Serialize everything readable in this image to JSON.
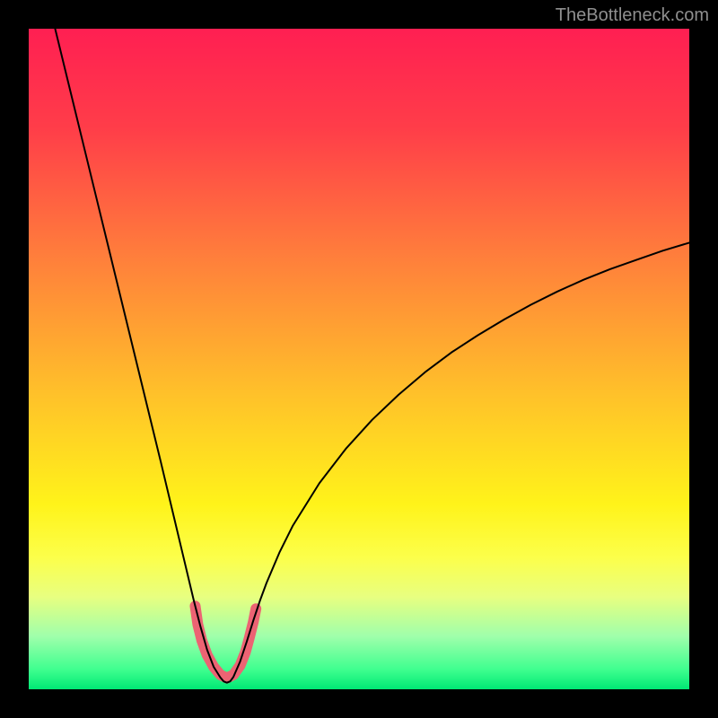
{
  "watermark": "TheBottleneck.com",
  "chart_data": {
    "type": "line",
    "title": "",
    "xlabel": "",
    "ylabel": "",
    "xlim": [
      0,
      100
    ],
    "ylim": [
      0,
      100
    ],
    "gradient_stops": [
      {
        "offset": 0.0,
        "color": "#ff1f52"
      },
      {
        "offset": 0.15,
        "color": "#ff3d49"
      },
      {
        "offset": 0.35,
        "color": "#ff803b"
      },
      {
        "offset": 0.55,
        "color": "#ffc02a"
      },
      {
        "offset": 0.72,
        "color": "#fff31a"
      },
      {
        "offset": 0.8,
        "color": "#fcff4a"
      },
      {
        "offset": 0.86,
        "color": "#e8ff80"
      },
      {
        "offset": 0.92,
        "color": "#9fffab"
      },
      {
        "offset": 0.97,
        "color": "#3fff8f"
      },
      {
        "offset": 1.0,
        "color": "#00e874"
      }
    ],
    "series": [
      {
        "name": "bottleneck-curve",
        "color": "#000000",
        "width": 2,
        "x": [
          4,
          6,
          8,
          10,
          12,
          14,
          16,
          18,
          20,
          22,
          23,
          24,
          25,
          26,
          27,
          28,
          29,
          29.5,
          30,
          30.5,
          31,
          32,
          33,
          34,
          35,
          36,
          38,
          40,
          44,
          48,
          52,
          56,
          60,
          64,
          68,
          72,
          76,
          80,
          84,
          88,
          92,
          96,
          100
        ],
        "y": [
          100,
          91.8,
          83.6,
          75.4,
          67.2,
          59.0,
          50.8,
          42.6,
          34.4,
          26.0,
          21.8,
          17.6,
          13.4,
          9.5,
          6.0,
          3.4,
          1.8,
          1.2,
          1.0,
          1.2,
          1.9,
          4.2,
          7.2,
          10.4,
          13.4,
          16.1,
          20.8,
          24.8,
          31.2,
          36.4,
          40.8,
          44.6,
          48.0,
          51.0,
          53.6,
          56.0,
          58.2,
          60.2,
          62.0,
          63.6,
          65.0,
          66.4,
          67.6
        ]
      },
      {
        "name": "valley-marker",
        "color": "#ec6373",
        "width": 12,
        "cap": "round",
        "x": [
          25.2,
          25.6,
          26.2,
          27.0,
          28.0,
          29.0,
          30.0,
          31.0,
          32.0,
          32.8,
          33.4,
          34.0,
          34.4
        ],
        "y": [
          12.6,
          9.8,
          7.4,
          5.2,
          3.4,
          2.2,
          1.7,
          2.2,
          3.6,
          5.6,
          7.8,
          10.2,
          12.2
        ]
      }
    ]
  }
}
